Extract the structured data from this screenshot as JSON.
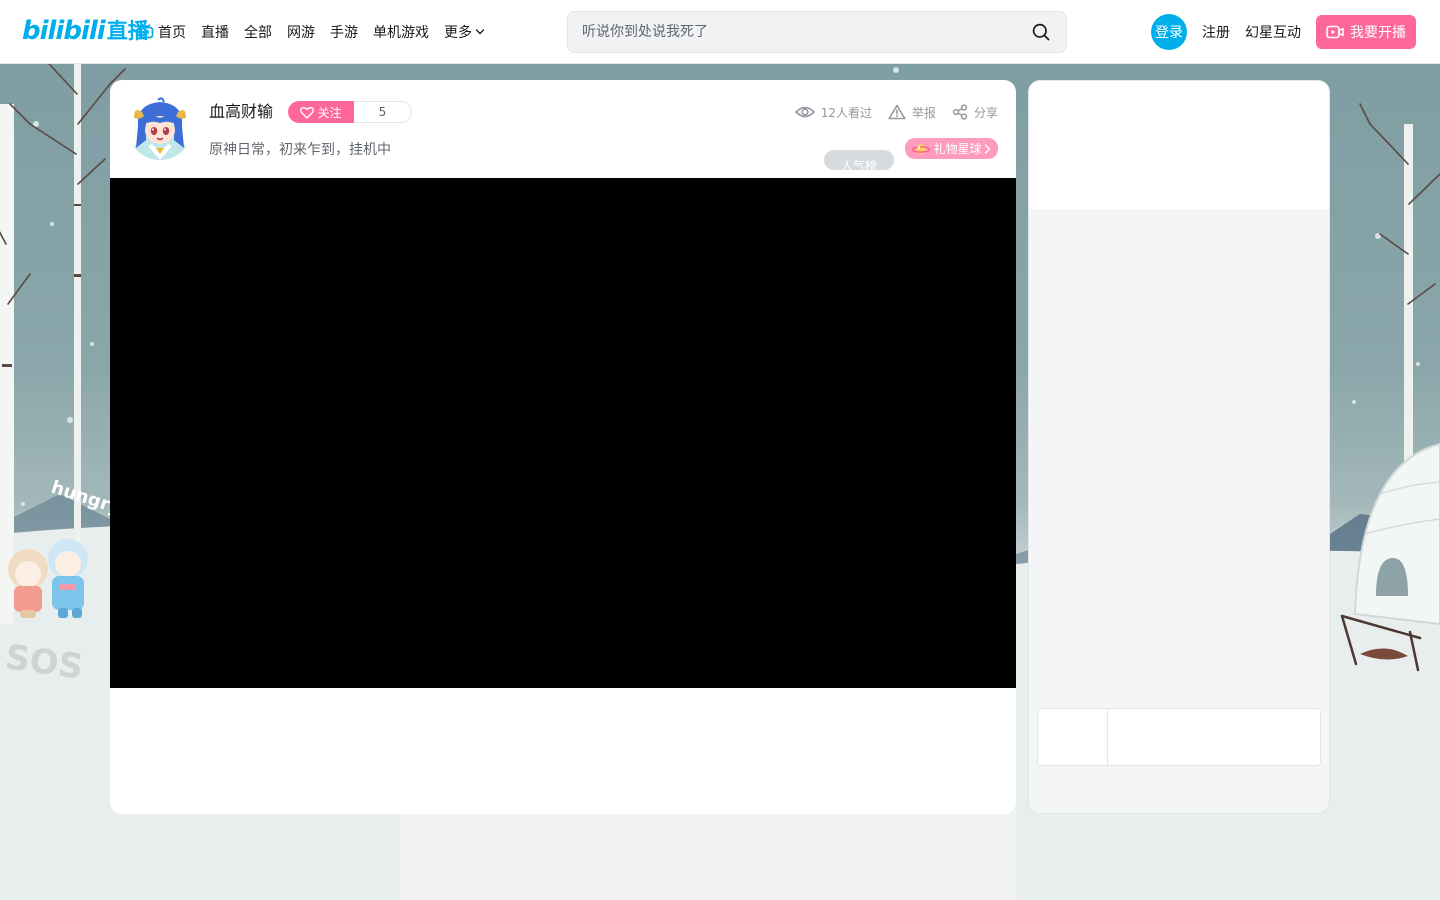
{
  "header": {
    "logo_text": "bilibili",
    "logo_suffix": "直播",
    "nav": [
      {
        "label": "首页",
        "icon": "tv-icon"
      },
      {
        "label": "直播"
      },
      {
        "label": "全部"
      },
      {
        "label": "网游"
      },
      {
        "label": "手游"
      },
      {
        "label": "单机游戏"
      },
      {
        "label": "更多",
        "icon": "chevron-down-icon"
      }
    ],
    "search": {
      "placeholder": "听说你到处说我死了",
      "value": ""
    },
    "login_label": "登录",
    "register_label": "注册",
    "brand_link": "幻星互动",
    "start_live_label": "我要开播"
  },
  "room": {
    "anchor_name": "血高财输",
    "follow_label": "关注",
    "follower_count": "5",
    "title": "原神日常，初来乍到，挂机中",
    "viewers_text": "12人看过",
    "report_label": "举报",
    "share_label": "分享",
    "rank_label": "人气榜",
    "gift_planet_label": "礼物星球"
  },
  "colors": {
    "brand_blue": "#00aeec",
    "brand_pink": "#ff6699",
    "video_bg": "#000000"
  }
}
